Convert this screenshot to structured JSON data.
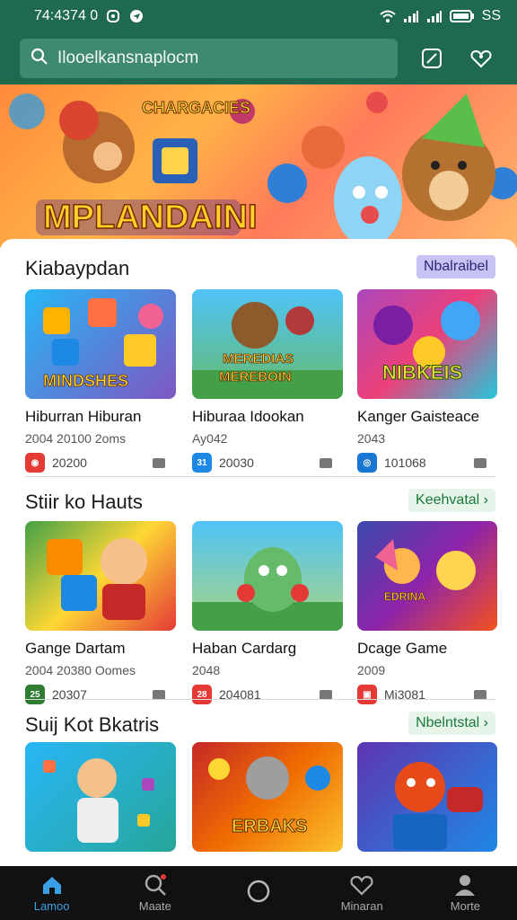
{
  "status_bar": {
    "time": "74:4374 0",
    "battery": "SS"
  },
  "search": {
    "placeholder": "Ilooelkansnaplocm"
  },
  "banner": {
    "title": "MPLANDAINI",
    "subtitle": "CHARGACIES"
  },
  "sections": [
    {
      "title": "Kiabaypdan",
      "link": "Nbalraibel",
      "cards": [
        {
          "name": "Hiburran Hiburan",
          "meta": "2004 20100 2oms",
          "badge": "20200",
          "thumb_text": "MINDSHES"
        },
        {
          "name": "Hiburaa Idookan",
          "meta": "Ay042",
          "badge": "20030",
          "thumb_text": "MEREDIAS MEREBOIN"
        },
        {
          "name": "Kanger Gaisteace",
          "meta": "2043",
          "badge": "101068",
          "thumb_text": "NIBKEIS"
        }
      ]
    },
    {
      "title": "Stiir ko Hauts",
      "link": "Keehvatal",
      "cards": [
        {
          "name": "Gange Dartam",
          "meta": "2004 20380 Oomes",
          "badge": "20307",
          "thumb_text": ""
        },
        {
          "name": "Haban Cardarg",
          "meta": "2048",
          "badge": "204081",
          "thumb_text": ""
        },
        {
          "name": "Dcage Game",
          "meta": "2009",
          "badge": "Mi3081",
          "thumb_text": "EDRINA"
        }
      ]
    },
    {
      "title": "Suij Kot Bkatris",
      "link": "Nbelntstal",
      "cards": [
        {
          "name": "",
          "meta": "",
          "badge": "",
          "thumb_text": ""
        },
        {
          "name": "",
          "meta": "",
          "badge": "",
          "thumb_text": "ERBAKS"
        },
        {
          "name": "",
          "meta": "",
          "badge": "",
          "thumb_text": ""
        }
      ]
    }
  ],
  "nav": [
    {
      "label": "Lamoo",
      "icon": "home-icon"
    },
    {
      "label": "Maate",
      "icon": "search-icon"
    },
    {
      "label": "",
      "icon": "circle-icon"
    },
    {
      "label": "Minaran",
      "icon": "heart-icon"
    },
    {
      "label": "Morte",
      "icon": "person-icon"
    }
  ],
  "colors": {
    "header": "#1f6a4f",
    "nav_active": "#3aa0e6",
    "link_green": "#1a7a3a",
    "link_purple": "#c7c3f4"
  }
}
